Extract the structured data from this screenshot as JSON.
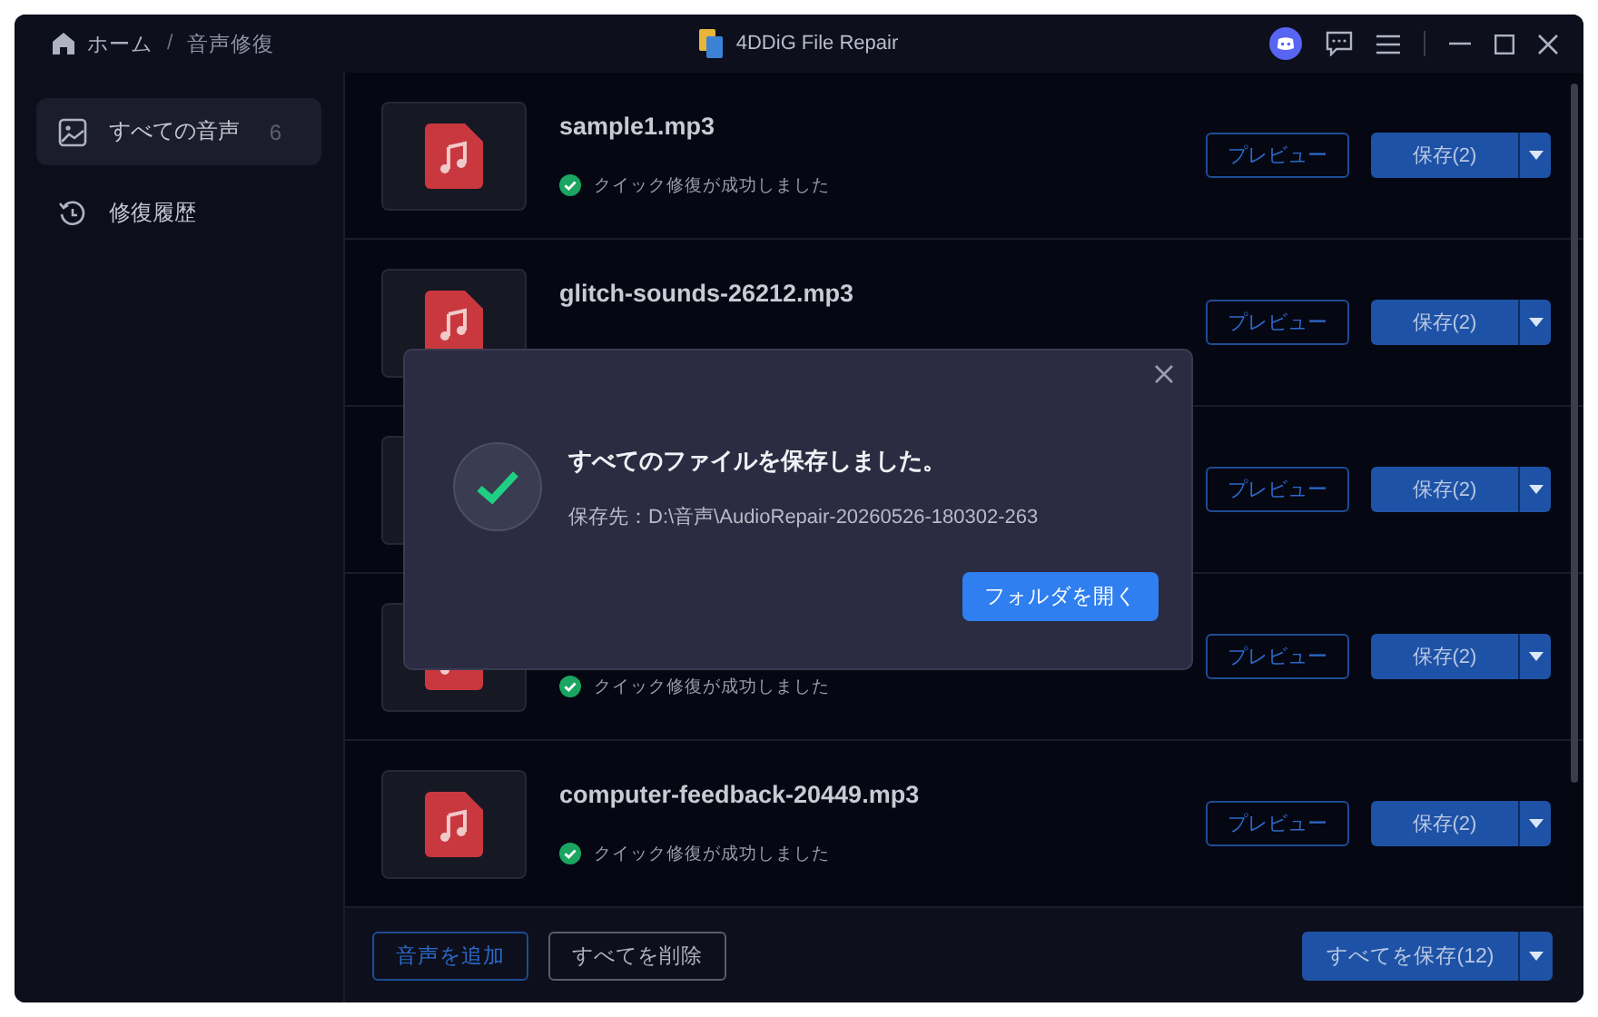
{
  "breadcrumb": {
    "items": [
      "ホーム",
      "音声修復"
    ],
    "separator": "/"
  },
  "window": {
    "title": "4DDiG File Repair"
  },
  "sidebar": {
    "items": [
      {
        "kind": "gallery",
        "label": "すべての音声",
        "count": "6",
        "selected": true
      },
      {
        "kind": "history",
        "label": "修復履歴",
        "selected": false
      }
    ]
  },
  "files": [
    {
      "name": "sample1.mp3",
      "status": "クイック修復が成功しました",
      "preview": "プレビュー",
      "save": "保存(2)"
    },
    {
      "name": "glitch-sounds-26212.mp3",
      "preview": "プレビュー",
      "save": "保存(2)"
    },
    {
      "preview": "プレビュー",
      "save": "保存(2)"
    },
    {
      "status": "クイック修復が成功しました",
      "preview": "プレビュー",
      "save": "保存(2)"
    },
    {
      "name": "computer-feedback-20449.mp3",
      "status": "クイック修復が成功しました",
      "preview": "プレビュー",
      "save": "保存(2)"
    }
  ],
  "footer": {
    "add": "音声を追加",
    "delete_all": "すべてを削除",
    "save_all": "すべてを保存(12)"
  },
  "dialog": {
    "title": "すべてのファイルを保存しました。",
    "path": "保存先：D:\\音声\\AudioRepair-20260526-180302-263",
    "button": "フォルダを開く"
  }
}
